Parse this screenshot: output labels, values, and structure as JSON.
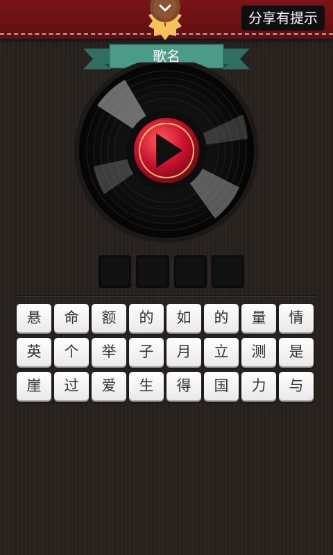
{
  "header": {
    "share_hint_label": "分享有提示"
  },
  "ribbon": {
    "title": "歌名"
  },
  "answer_slots": [
    "",
    "",
    "",
    ""
  ],
  "characters": [
    "悬",
    "命",
    "额",
    "的",
    "如",
    "的",
    "量",
    "情",
    "英",
    "个",
    "举",
    "子",
    "月",
    "立",
    "测",
    "是",
    "崖",
    "过",
    "爱",
    "生",
    "得",
    "国",
    "力",
    "与"
  ],
  "icons": {
    "badge": "chevron-down-icon",
    "play": "play-icon"
  },
  "colors": {
    "topbar": "#6b1115",
    "ribbon": "#3f8f7c",
    "play_button": "#c8102e",
    "background": "#2b2522"
  }
}
